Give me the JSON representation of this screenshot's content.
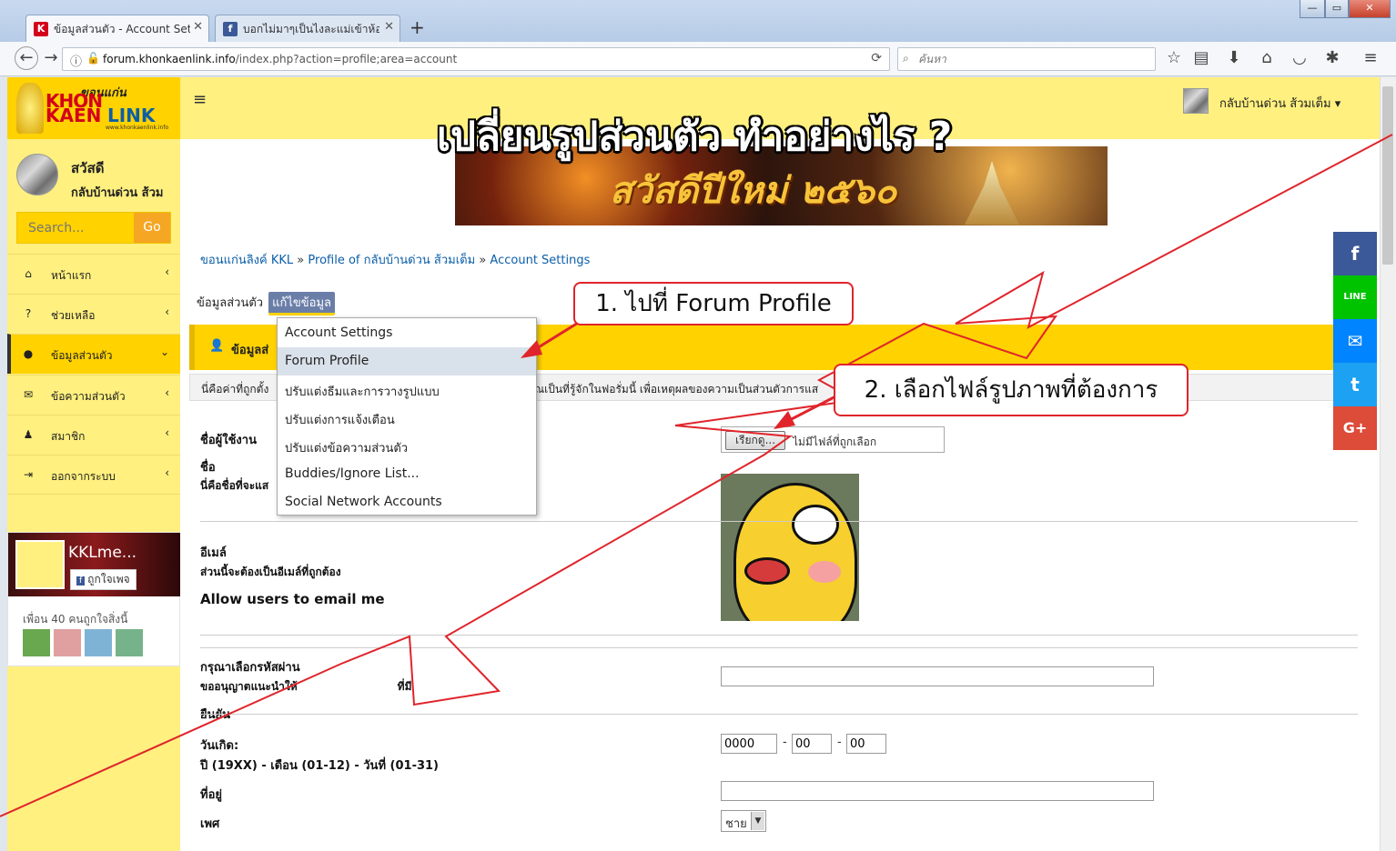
{
  "browser": {
    "tabs": [
      {
        "title": "ข้อมูลส่วนตัว - Account Settings",
        "favicon": "K",
        "favicon_color": "#d4001a",
        "active": true
      },
      {
        "title": "บอกไม่มาๆเป็นไงละแม่เข้าห้อง",
        "favicon": "f",
        "favicon_color": "#3b5998",
        "active": false
      }
    ],
    "new_tab": "+",
    "url_domain": "forum.khonkaenlink.info",
    "url_path": "/index.php?action=profile;area=account",
    "search_placeholder": "ค้นหา",
    "window_controls": {
      "minimize": "—",
      "maximize": "▭",
      "close": "✕"
    }
  },
  "sidebar": {
    "logo_text_a": "KHON",
    "logo_text_b": "KAEN",
    "logo_text_c": "LINK",
    "logo_thai": "ขอนแก่น",
    "logo_url": "www.khonkaenlink.info",
    "greeting": "สวัสดี",
    "username": "กลับบ้านด่วน ส้วม",
    "search_placeholder": "Search...",
    "search_button": "Go",
    "menu": [
      {
        "label": "หน้าแรก",
        "icon": "home-icon",
        "glyph": "⌂",
        "chev": "‹",
        "active": false
      },
      {
        "label": "ช่วยเหลือ",
        "icon": "question-icon",
        "glyph": "?",
        "chev": "‹",
        "active": false
      },
      {
        "label": "ข้อมูลส่วนตัว",
        "icon": "user-icon",
        "glyph": "●",
        "chev": "⌄",
        "active": true
      },
      {
        "label": "ข้อความส่วนตัว",
        "icon": "envelope-icon",
        "glyph": "✉",
        "chev": "‹",
        "active": false
      },
      {
        "label": "สมาชิก",
        "icon": "users-icon",
        "glyph": "♟",
        "chev": "‹",
        "active": false
      },
      {
        "label": "ออกจากระบบ",
        "icon": "signout-icon",
        "glyph": "⇥",
        "chev": "‹",
        "active": false
      }
    ],
    "fb_page": {
      "name": "KKLme...",
      "like_button": "ถูกใจเพจ",
      "friends_text": "เพื่อน 40 คนถูกใจสิ่งนี้"
    }
  },
  "header": {
    "user_name": "กลับบ้านด่วน ส้วมเต็ม",
    "user_caret": "▾",
    "big_title": "เปลี่ยนรูปส่วนตัว ทำอย่างไร ?",
    "banner_text": "สวัสดีปีใหม่ ๒๕๖๐"
  },
  "breadcrumb": [
    "ขอนแก่นลิงค์ KKL",
    "Profile of กลับบ้านด่วน ส้วมเต็ม",
    "Account Settings"
  ],
  "breadcrumb_sep": "»",
  "tabs": {
    "first": "ข้อมูลส่วนตัว",
    "selected": "แก้ไขข้อมูล"
  },
  "dropdown": [
    {
      "label": "Account Settings",
      "hover": false
    },
    {
      "label": "Forum Profile",
      "hover": true
    },
    {
      "label": "ปรับแต่งธีมและการวางรูปแบบ",
      "hover": false
    },
    {
      "label": "ปรับแต่งการแจ้งเตือน",
      "hover": false
    },
    {
      "label": "ปรับแต่งข้อความส่วนตัว",
      "hover": false
    },
    {
      "label": "Buddies/Ignore List...",
      "hover": false
    },
    {
      "label": "Social Network Accounts",
      "hover": false
    }
  ],
  "section": {
    "title_visible": "ข้อมูลส่",
    "desc_left": "นี่คือค่าที่ถูกตั้ง",
    "desc_right": "ณเป็นที่รู้จักในฟอรั่มนี้ เพื่อเหตุผลของความเป็นส่วนตัวการแส"
  },
  "form": {
    "username_label": "ชื่อผู้ใช้งาน",
    "name_label": "ชื่อ",
    "name_sub": "นี่คือชื่อที่จะแส",
    "email_label": "อีเมล์",
    "email_sub": "ส่วนนี้จะต้องเป็นอีเมล์ที่ถูกต้อง",
    "allow_email": "Allow users to email me",
    "password_label": "กรุณาเลือกรหัสผ่าน",
    "password_sub_a": "ขออนุญาตแนะนำให้",
    "password_sub_b": "ที่มี",
    "confirm_label": "ยืนยัน",
    "birthdate_label": "วันเกิด:",
    "birthdate_sub": "ปี (19XX) - เดือน (01-12) - วันที่ (01-31)",
    "birth_year": "0000",
    "birth_month": "00",
    "birth_day": "00",
    "date_sep": "-",
    "address_label": "ที่อยู่",
    "gender_label": "เพศ",
    "gender_value": "ชาย",
    "file_button": "เรียกดู...",
    "file_none": "ไม่มีไฟล์ที่ถูกเลือก"
  },
  "callouts": {
    "step1": "1. ไปที่ Forum Profile",
    "step2": "2. เลือกไฟล์รูปภาพที่ต้องการ"
  },
  "share": [
    {
      "icon": "facebook-icon",
      "glyph": "f",
      "color": "#3b5998"
    },
    {
      "icon": "line-icon",
      "glyph": "LINE",
      "color": "#00c300"
    },
    {
      "icon": "messenger-icon",
      "glyph": "✉",
      "color": "#0084ff"
    },
    {
      "icon": "twitter-icon",
      "glyph": "t",
      "color": "#1da1f2"
    },
    {
      "icon": "googleplus-icon",
      "glyph": "G+",
      "color": "#dd4b39"
    }
  ],
  "colors": {
    "sidebar": "#fff07f",
    "accent": "#ffd200",
    "annotation": "#e0242b"
  }
}
